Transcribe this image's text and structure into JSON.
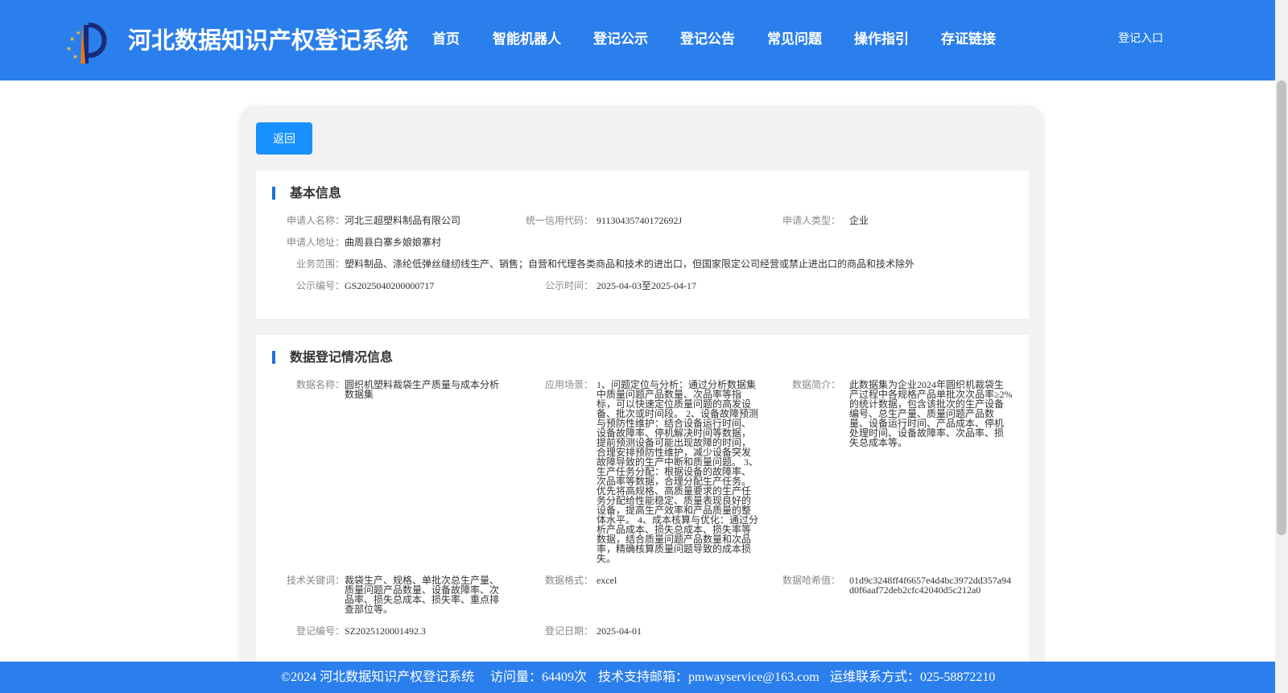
{
  "header": {
    "site_title": "河北数据知识产权登记系统",
    "nav": [
      "首页",
      "智能机器人",
      "登记公示",
      "登记公告",
      "常见问题",
      "操作指引",
      "存证链接"
    ],
    "login_label": "登记入口"
  },
  "back_label": "返回",
  "basic_info": {
    "title": "基本信息",
    "applicant_name_label": "申请人名称：",
    "applicant_name": "河北三超塑料制品有限公司",
    "credit_code_label": "统一信用代码：",
    "credit_code": "91130435740172692J",
    "applicant_type_label": "申请人类型：",
    "applicant_type": "企业",
    "address_label": "申请人地址：",
    "address": "曲周县白寨乡娘娘寨村",
    "scope_label": "业务范围：",
    "scope": "塑料制品、涤纶低弹丝缝纫线生产、销售；自营和代理各类商品和技术的进出口，但国家限定公司经营或禁止进出口的商品和技术除外",
    "notice_no_label": "公示编号：",
    "notice_no": "GS2025040200000717",
    "notice_time_label": "公示时间：",
    "notice_time": "2025-04-03至2025-04-17"
  },
  "data_info": {
    "title": "数据登记情况信息",
    "data_name_label": "数据名称：",
    "data_name": "圆织机塑料裁袋生产质量与成本分析数据集",
    "scenario_label": "应用场景：",
    "scenario": "1、问题定位与分析：通过分析数据集中质量问题产品数量、次品率等指标，可以快速定位质量问题的高发设备、批次或时间段。 2、设备故障预测与预防性维护：结合设备运行时间、设备故障率、停机解决时间等数据，提前预测设备可能出现故障的时间，合理安排预防性维护，减少设备突发故障导致的生产中断和质量问题。 3、生产任务分配：根据设备的故障率、次品率等数据，合理分配生产任务。优先将高规格、高质量要求的生产任务分配给性能稳定、质量表现良好的设备，提高生产效率和产品质量的整体水平。 4、成本核算与优化：通过分析产品成本、损失总成本、损失率等数据，结合质量问题产品数量和次品率，精确核算质量问题导致的成本损失。",
    "summary_label": "数据简介：",
    "summary": "此数据集为企业2024年圆织机裁袋生产过程中各规格产品单批次次品率≥2%的统计数据，包含该批次的生产设备编号、总生产量、质量问题产品数量、设备运行时间、产品成本、停机处理时间、设备故障率、次品率、损失总成本等。",
    "keywords_label": "技术关键词：",
    "keywords": "裁袋生产、规格、单批次总生产量、质量问题产品数量、设备故障率、次品率、损失总成本、损失率、重点排查部位等。",
    "format_label": "数据格式：",
    "format": "excel",
    "hash_label": "数据哈希值：",
    "hash": "01d9c3248ff4f6657e4d4bc3972dd357a94d0f6aaf72deb2cfc42040d5c212a0",
    "reg_no_label": "登记编号：",
    "reg_no": "SZ2025120001492.3",
    "reg_date_label": "登记日期：",
    "reg_date": "2025-04-01"
  },
  "footer": {
    "copyright": "©2024 河北数据知识产权登记系统",
    "visits": "访问量：64409次",
    "support_email": "技术支持邮箱：pmwayservice@163.com",
    "contact": "运维联系方式：025-58872210"
  },
  "colors": {
    "header_bg": "#2b7fec",
    "primary_button": "#1890ff",
    "title_accent": "#1e6fd9"
  }
}
